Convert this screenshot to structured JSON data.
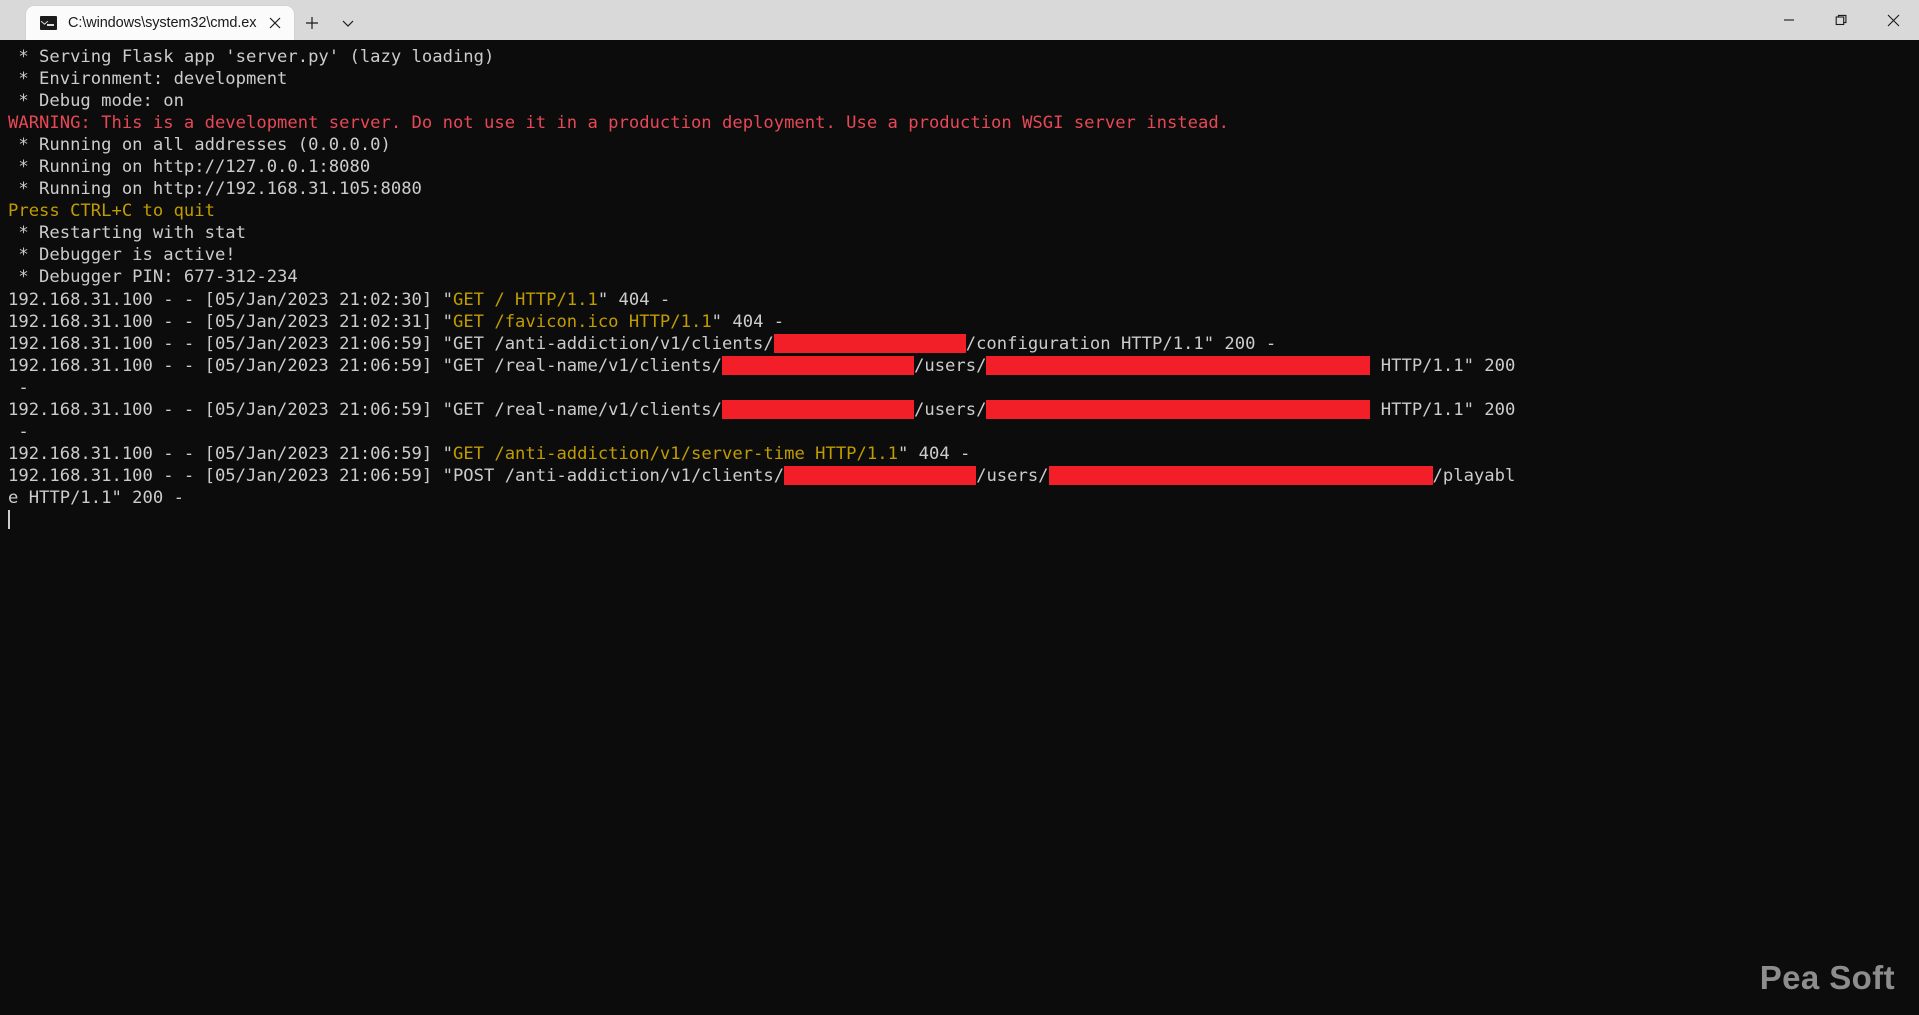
{
  "window": {
    "title": "C:\\windows\\system32\\cmd.ex",
    "tab_icon": "terminal-icon",
    "close_tab_icon": "close-icon",
    "new_tab_icon": "plus-icon",
    "tab_dropdown_icon": "chevron-down-icon",
    "minimize_icon": "minimize-icon",
    "maximize_icon": "maximize-icon",
    "close_icon": "close-icon"
  },
  "watermark": "Pea Soft",
  "colors": {
    "terminal_bg": "#0c0c0c",
    "text": "#cccccc",
    "warning_red": "#e74856",
    "prompt_yellow": "#c19c00",
    "redaction": "#f21f28",
    "chrome_bg": "#d9d9d9",
    "tab_bg": "#fbfbfb"
  },
  "console": {
    "lines": [
      {
        "segments": [
          {
            "text": " * Serving Flask app 'server.py' (lazy loading)",
            "color": "white"
          }
        ]
      },
      {
        "segments": [
          {
            "text": " * Environment: development",
            "color": "white"
          }
        ]
      },
      {
        "segments": [
          {
            "text": " * Debug mode: on",
            "color": "white"
          }
        ]
      },
      {
        "segments": [
          {
            "text": "WARNING: This is a development server. Do not use it in a production deployment. Use a production WSGI server instead.",
            "color": "red"
          }
        ]
      },
      {
        "segments": [
          {
            "text": " * Running on all addresses (0.0.0.0)",
            "color": "white"
          }
        ]
      },
      {
        "segments": [
          {
            "text": " * Running on http://127.0.0.1:8080",
            "color": "white"
          }
        ]
      },
      {
        "segments": [
          {
            "text": " * Running on http://192.168.31.105:8080",
            "color": "white"
          }
        ]
      },
      {
        "segments": [
          {
            "text": "Press CTRL+C to quit",
            "color": "yellow"
          }
        ]
      },
      {
        "segments": [
          {
            "text": " * Restarting with stat",
            "color": "white"
          }
        ]
      },
      {
        "segments": [
          {
            "text": " * Debugger is active!",
            "color": "white"
          }
        ]
      },
      {
        "segments": [
          {
            "text": " * Debugger PIN: 677-312-234",
            "color": "white"
          }
        ]
      },
      {
        "segments": [
          {
            "text": "192.168.31.100 - - [05/Jan/2023 21:02:30] \"",
            "color": "white"
          },
          {
            "text": "GET / HTTP/1.1",
            "color": "yellow"
          },
          {
            "text": "\" 404 -",
            "color": "white"
          }
        ]
      },
      {
        "segments": [
          {
            "text": "192.168.31.100 - - [05/Jan/2023 21:02:31] \"",
            "color": "white"
          },
          {
            "text": "GET /favicon.ico HTTP/1.1",
            "color": "yellow"
          },
          {
            "text": "\" 404 -",
            "color": "white"
          }
        ]
      },
      {
        "segments": [
          {
            "text": "192.168.31.100 - - [05/Jan/2023 21:06:59] \"GET /anti-addiction/v1/clients/",
            "color": "white"
          },
          {
            "redact": 192
          },
          {
            "text": "/configuration HTTP/1.1\" 200 -",
            "color": "white"
          }
        ]
      },
      {
        "segments": [
          {
            "text": "192.168.31.100 - - [05/Jan/2023 21:06:59] \"GET /real-name/v1/clients/",
            "color": "white"
          },
          {
            "redact": 192
          },
          {
            "text": "/users/",
            "color": "white"
          },
          {
            "redact": 384
          },
          {
            "text": " HTTP/1.1\" 200",
            "color": "white"
          }
        ]
      },
      {
        "segments": [
          {
            "text": " -",
            "color": "white"
          }
        ]
      },
      {
        "segments": [
          {
            "text": "192.168.31.100 - - [05/Jan/2023 21:06:59] \"GET /real-name/v1/clients/",
            "color": "white"
          },
          {
            "redact": 192
          },
          {
            "text": "/users/",
            "color": "white"
          },
          {
            "redact": 384
          },
          {
            "text": " HTTP/1.1\" 200",
            "color": "white"
          }
        ]
      },
      {
        "segments": [
          {
            "text": " -",
            "color": "white"
          }
        ]
      },
      {
        "segments": [
          {
            "text": "192.168.31.100 - - [05/Jan/2023 21:06:59] \"",
            "color": "white"
          },
          {
            "text": "GET /anti-addiction/v1/server-time HTTP/1.1",
            "color": "yellow"
          },
          {
            "text": "\" 404 -",
            "color": "white"
          }
        ]
      },
      {
        "segments": [
          {
            "text": "192.168.31.100 - - [05/Jan/2023 21:06:59] \"POST /anti-addiction/v1/clients/",
            "color": "white"
          },
          {
            "redact": 192
          },
          {
            "text": "/users/",
            "color": "white"
          },
          {
            "redact": 384
          },
          {
            "text": "/playabl",
            "color": "white"
          }
        ]
      },
      {
        "segments": [
          {
            "text": "e HTTP/1.1\" 200 -",
            "color": "white"
          }
        ]
      },
      {
        "segments": [
          {
            "cursor": true
          }
        ]
      }
    ]
  }
}
